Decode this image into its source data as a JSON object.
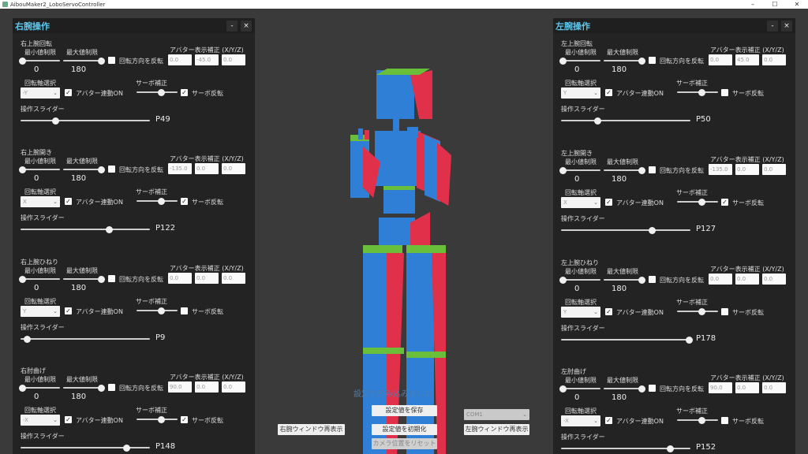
{
  "window": {
    "title": "AibouMaker2_LoboServoController",
    "minimize": "–",
    "maximize": "☐",
    "close": "✕"
  },
  "panel_controls": {
    "minimize": "-",
    "close": "×"
  },
  "labels": {
    "min": "最小値制限",
    "max": "最大値制限",
    "reverse": "回転方向を反転",
    "avatar_offset": "アバター表示補正 (X/Y/Z)",
    "axis_select": "回転軸選択",
    "avatar_link": "アバター連動ON",
    "servo_correction": "サーボ補正",
    "servo_reverse": "サーボ反転",
    "op_slider": "操作スライダー",
    "min_value": "0",
    "max_value": "180",
    "check": "✓"
  },
  "right_panel": {
    "title": "右腕操作",
    "sections": [
      {
        "title": "右上腕回転",
        "axis": "-Y",
        "offset": [
          "0.0",
          "-45.0",
          "0.0"
        ],
        "reverse": false,
        "avatar_link": true,
        "servo_reverse": true,
        "servo_level": 0.6,
        "slider_value": "P49",
        "slider_level": 0.27
      },
      {
        "title": "右上腕開き",
        "axis": "X",
        "offset": [
          "-135.0",
          "0.0",
          "0.0"
        ],
        "reverse": false,
        "avatar_link": true,
        "servo_reverse": true,
        "servo_level": 0.6,
        "slider_value": "P122",
        "slider_level": 0.68
      },
      {
        "title": "右上腕ひねり",
        "axis": "Y",
        "offset": [
          "0.0",
          "0.0",
          "0.0"
        ],
        "reverse": false,
        "avatar_link": true,
        "servo_reverse": false,
        "servo_level": 0.6,
        "slider_value": "P9",
        "slider_level": 0.05
      },
      {
        "title": "右肘曲げ",
        "axis": "-X",
        "offset": [
          "90.0",
          "0.0",
          "0.0"
        ],
        "reverse": false,
        "avatar_link": true,
        "servo_reverse": true,
        "servo_level": 0.6,
        "slider_value": "P148",
        "slider_level": 0.82
      }
    ]
  },
  "left_panel": {
    "title": "左腕操作",
    "sections": [
      {
        "title": "左上腕回転",
        "axis": "Y",
        "offset": [
          "0.0",
          "45.0",
          "0.0"
        ],
        "reverse": false,
        "avatar_link": true,
        "servo_reverse": false,
        "servo_level": 0.6,
        "slider_value": "P50",
        "slider_level": 0.28
      },
      {
        "title": "左上腕開き",
        "axis": "X",
        "offset": [
          "-135.0",
          "0.0",
          "0.0"
        ],
        "reverse": false,
        "avatar_link": true,
        "servo_reverse": true,
        "servo_level": 0.6,
        "slider_value": "P127",
        "slider_level": 0.7
      },
      {
        "title": "左上腕ひねり",
        "axis": "Y",
        "offset": [
          "0.0",
          "0.0",
          "0.0"
        ],
        "reverse": false,
        "avatar_link": true,
        "servo_reverse": false,
        "servo_level": 0.6,
        "slider_value": "P178",
        "slider_level": 0.99
      },
      {
        "title": "左肘曲げ",
        "axis": "-X",
        "offset": [
          "90.0",
          "0.0",
          "0.0"
        ],
        "reverse": false,
        "avatar_link": true,
        "servo_reverse": false,
        "servo_level": 0.6,
        "slider_value": "P152",
        "slider_level": 0.84
      }
    ]
  },
  "center": {
    "status": "設定を読み込みました",
    "save": "設定値を保存",
    "reset": "設定値を初期化",
    "camera_reset": "カメラ位置をリセット",
    "right_window": "右腕ウィンドウ再表示",
    "left_window": "左腕ウィンドウ再表示",
    "com_port": "COM1"
  },
  "colors": {
    "accent": "#5ec8ee",
    "robot_blue": "#2f7fd6",
    "robot_red": "#e0304a",
    "robot_green": "#6abf3a"
  }
}
